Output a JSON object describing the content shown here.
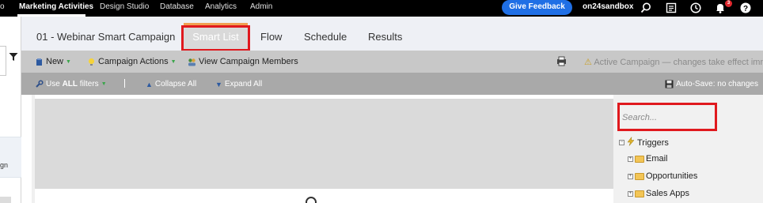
{
  "topnav": {
    "partial_item": "o",
    "items": [
      "Marketing Activities",
      "Design Studio",
      "Database",
      "Analytics",
      "Admin"
    ],
    "active_item": "Marketing Activities",
    "feedback_label": "Give Feedback",
    "instance": "on24sandbox",
    "notification_count": "3",
    "icons": [
      "search-icon",
      "calendar-icon",
      "clock-icon",
      "bell-icon",
      "help-icon"
    ]
  },
  "sidebar": {
    "cut_text": "gn"
  },
  "tabs": {
    "campaign_name": "01 - Webinar Smart Campaign",
    "items": [
      "Smart List",
      "Flow",
      "Schedule",
      "Results"
    ],
    "active": "Smart List"
  },
  "toolbar": {
    "new_label": "New",
    "campaign_actions_label": "Campaign Actions",
    "view_members_label": "View Campaign Members",
    "status": "Active Campaign — changes take effect immed"
  },
  "filterbar": {
    "use_prefix": "Use ",
    "use_bold": "ALL",
    "use_suffix": " filters",
    "separator": "|",
    "collapse_label": "Collapse All",
    "expand_label": "Expand All",
    "autosave": "Auto-Save: no changes"
  },
  "search": {
    "placeholder": "Search..."
  },
  "tree": {
    "root": "Triggers",
    "children": [
      "Email",
      "Opportunities",
      "Sales Apps"
    ]
  },
  "colors": {
    "accent_blue": "#1f6fe5",
    "highlight_red": "#e0191e",
    "tab_orange": "#f0a052",
    "green_arrow": "#3aa54a"
  }
}
